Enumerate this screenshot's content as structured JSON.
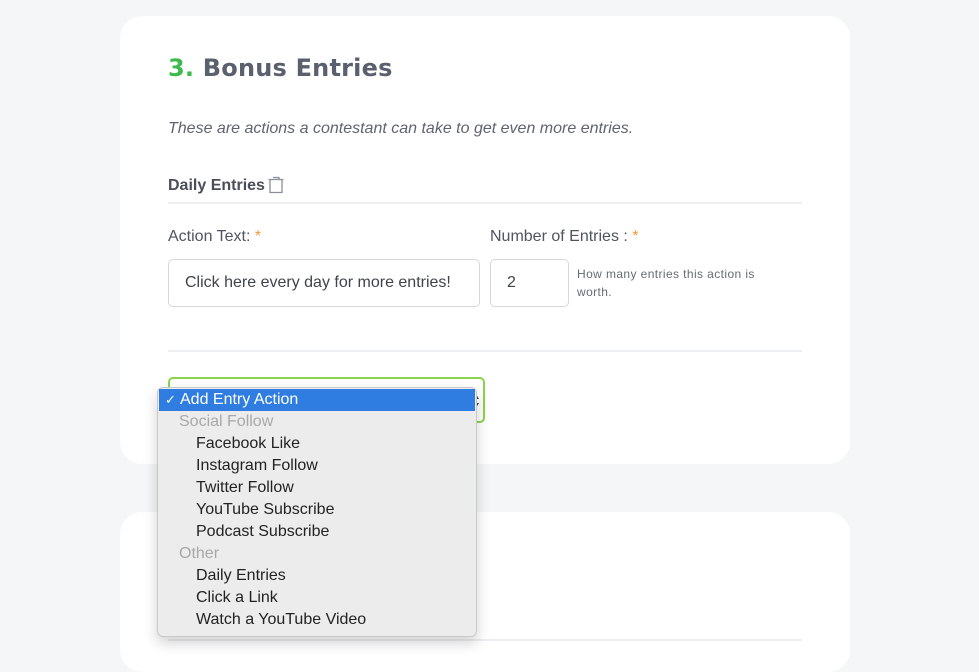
{
  "section": {
    "number": "3.",
    "title": "Bonus Entries",
    "description": "These are actions a contestant can take to get even more entries."
  },
  "entry_block": {
    "heading": "Daily Entries",
    "delete_icon": "trash-icon",
    "action_text_label": "Action Text:",
    "action_text_value": "Click here every day for more entries!",
    "num_entries_label": "Number of Entries :",
    "num_entries_value": "2",
    "num_entries_hint": "How many entries this action is worth.",
    "required_marker": "*"
  },
  "add_action_select": {
    "selected": "Add Entry Action",
    "options": [
      {
        "label": "Add Entry Action",
        "type": "option",
        "selected": true
      },
      {
        "label": "Social Follow",
        "type": "group"
      },
      {
        "label": "Facebook Like",
        "type": "option"
      },
      {
        "label": "Instagram Follow",
        "type": "option"
      },
      {
        "label": "Twitter Follow",
        "type": "option"
      },
      {
        "label": "YouTube Subscribe",
        "type": "option"
      },
      {
        "label": "Podcast Subscribe",
        "type": "option"
      },
      {
        "label": "Other",
        "type": "group"
      },
      {
        "label": "Daily Entries",
        "type": "option"
      },
      {
        "label": "Click a Link",
        "type": "option"
      },
      {
        "label": "Watch a YouTube Video",
        "type": "option"
      }
    ]
  },
  "colors": {
    "accent_green": "#3cbb4c",
    "required_orange": "#f29a38",
    "select_focus": "#8bd34a",
    "highlight_blue": "#2f7de1"
  }
}
